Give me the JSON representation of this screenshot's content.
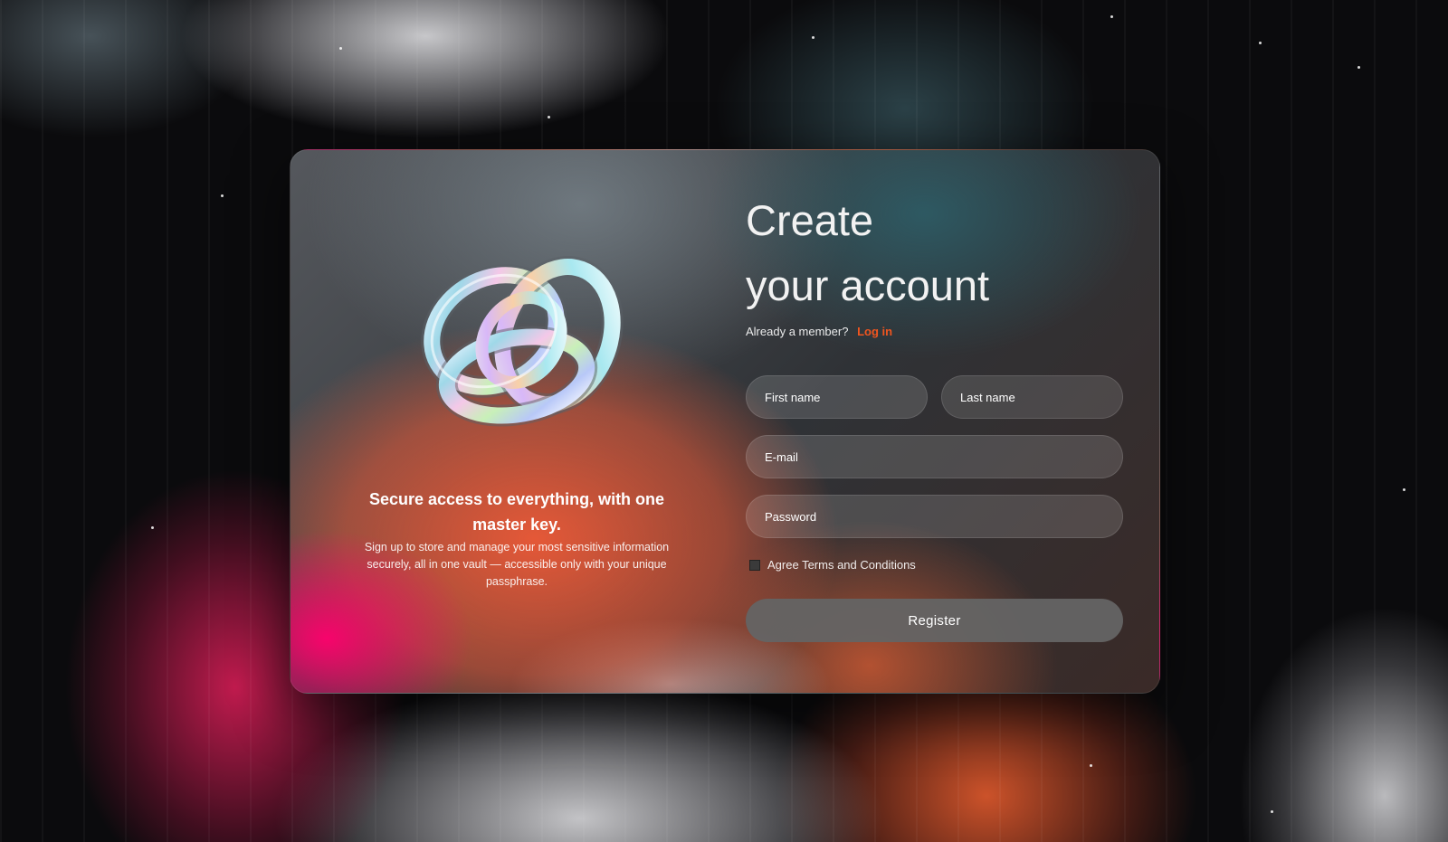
{
  "left_panel": {
    "knot_image": "iridescent-knot-icon",
    "tagline_title": "Secure access to everything, with one master key.",
    "tagline_body": "Sign up to store and manage your most sensitive information securely, all in one vault — accessible only with your unique passphrase."
  },
  "form": {
    "title_line1": "Create",
    "title_line2": "your account",
    "member_prompt": "Already a member?",
    "login_link": "Log in",
    "first_name_placeholder": "First name",
    "last_name_placeholder": "Last name",
    "email_placeholder": "E-mail",
    "password_placeholder": "Password",
    "terms_label": "Agree Terms and Conditions",
    "terms_checked": false,
    "register_label": "Register"
  },
  "colors": {
    "accent": "#f0551f",
    "button_bg": "#646464"
  }
}
